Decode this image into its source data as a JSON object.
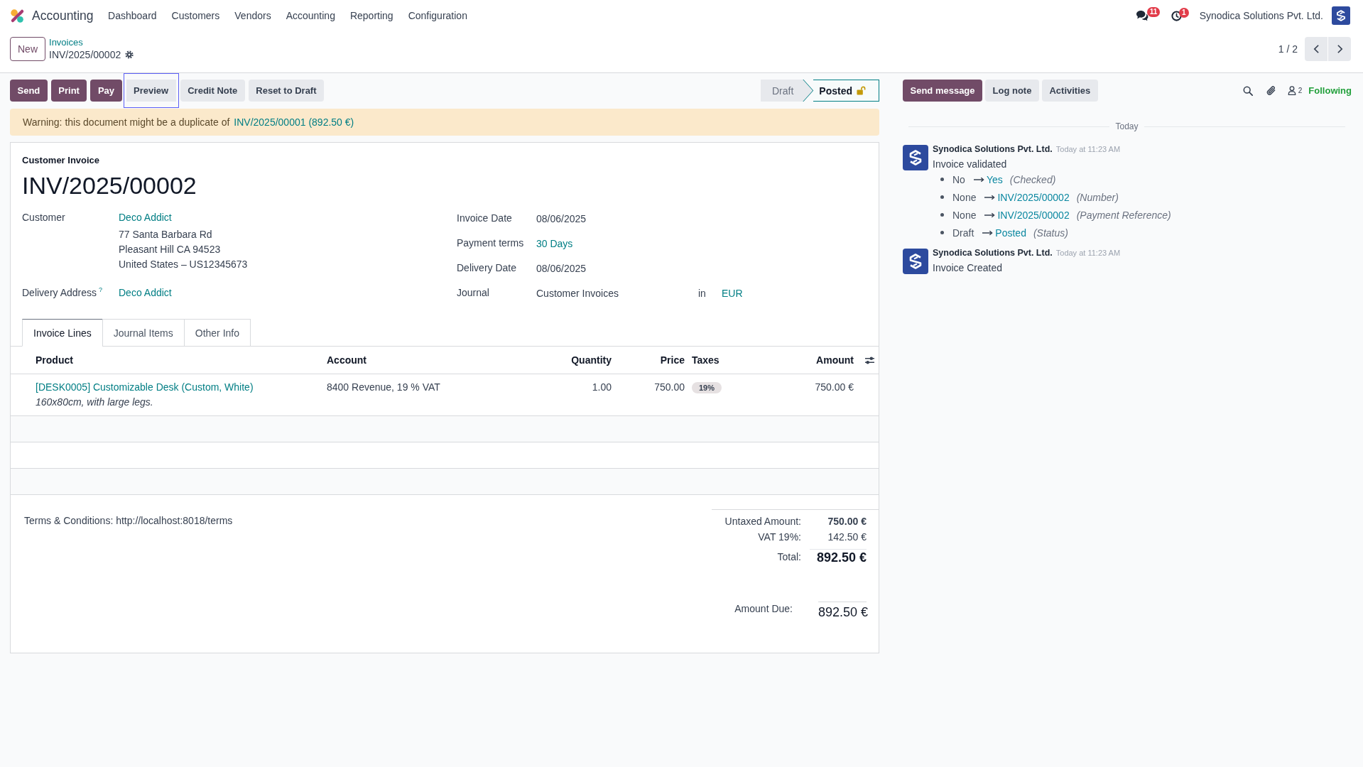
{
  "navbar": {
    "app_name": "Accounting",
    "menu": [
      "Dashboard",
      "Customers",
      "Vendors",
      "Accounting",
      "Reporting",
      "Configuration"
    ],
    "messages_badge": "11",
    "activities_badge": "1",
    "company": "Synodica Solutions Pvt. Ltd."
  },
  "control_panel": {
    "new_button": "New",
    "breadcrumb": "Invoices",
    "record_name": "INV/2025/00002",
    "pager": "1 / 2"
  },
  "actions": [
    {
      "label": "Send",
      "kind": "primary",
      "focused": false
    },
    {
      "label": "Print",
      "kind": "primary",
      "focused": false
    },
    {
      "label": "Pay",
      "kind": "primary",
      "focused": false
    },
    {
      "label": "Preview",
      "kind": "secondary",
      "focused": true
    },
    {
      "label": "Credit Note",
      "kind": "secondary",
      "focused": false
    },
    {
      "label": "Reset to Draft",
      "kind": "secondary",
      "focused": false
    }
  ],
  "status_bar": [
    {
      "label": "Draft",
      "selected": false,
      "lock_icon": false
    },
    {
      "label": "Posted",
      "selected": true,
      "lock_icon": true
    }
  ],
  "warning": {
    "text": "Warning: this document might be a duplicate of",
    "link": "INV/2025/00001 (892.50 €)"
  },
  "invoice": {
    "type_label": "Customer Invoice",
    "number": "INV/2025/00002",
    "left_fields": [
      {
        "label": "Customer",
        "value": "Deco Addict",
        "kind": "link",
        "address": [
          "77 Santa Barbara Rd",
          "Pleasant Hill CA 94523",
          "United States – US12345673"
        ]
      },
      {
        "label": "Delivery Address",
        "help": "?",
        "value": "Deco Addict",
        "kind": "link"
      }
    ],
    "right_fields": [
      {
        "label": "Invoice Date",
        "value": "08/06/2025",
        "kind": "text"
      },
      {
        "label": "Payment terms",
        "value": "30 Days",
        "kind": "link"
      },
      {
        "label": "Delivery Date",
        "value": "08/06/2025",
        "kind": "text"
      },
      {
        "label": "Journal",
        "value": "Customer Invoices",
        "kind": "journal",
        "connector": "in",
        "currency": "EUR"
      }
    ]
  },
  "tabs": [
    {
      "label": "Invoice Lines",
      "selected": true
    },
    {
      "label": "Journal Items",
      "selected": false
    },
    {
      "label": "Other Info",
      "selected": false
    }
  ],
  "invoice_lines": {
    "columns": [
      "Product",
      "Account",
      "Quantity",
      "Price",
      "Taxes",
      "Amount"
    ],
    "rows": [
      {
        "product": "[DESK0005] Customizable Desk (Custom, White)",
        "description": "160x80cm, with large legs.",
        "account": "8400 Revenue, 19 % VAT",
        "quantity": "1.00",
        "price": "750.00",
        "taxes": [
          "19%"
        ],
        "amount": "750.00 €"
      }
    ]
  },
  "terms": "Terms & Conditions: http://localhost:8018/terms",
  "totals": [
    {
      "label": "Untaxed Amount:",
      "value": "750.00 €",
      "kind": "subtotal"
    },
    {
      "label": "VAT 19%:",
      "value": "142.50 €",
      "kind": "tax"
    },
    {
      "label": "Total:",
      "value": "892.50 €",
      "kind": "total"
    }
  ],
  "amount_due": {
    "label": "Amount Due:",
    "value": "892.50 €"
  },
  "chatter": {
    "buttons": [
      {
        "label": "Send message",
        "kind": "primary"
      },
      {
        "label": "Log note",
        "kind": "secondary"
      },
      {
        "label": "Activities",
        "kind": "secondary"
      }
    ],
    "followers_count": "2",
    "follow_button": "Following",
    "date_separator": "Today",
    "messages": [
      {
        "author": "Synodica Solutions Pvt. Ltd.",
        "time": "Today at 11:23 AM",
        "body": "Invoice validated",
        "changes": [
          {
            "old": "No",
            "new": "Yes",
            "field": "(Checked)"
          },
          {
            "old": "None",
            "new": "INV/2025/00002",
            "field": "(Number)"
          },
          {
            "old": "None",
            "new": "INV/2025/00002",
            "field": "(Payment Reference)"
          },
          {
            "old": "Draft",
            "new": "Posted",
            "field": "(Status)"
          }
        ]
      },
      {
        "author": "Synodica Solutions Pvt. Ltd.",
        "time": "Today at 11:23 AM",
        "body": "Invoice Created"
      }
    ]
  }
}
